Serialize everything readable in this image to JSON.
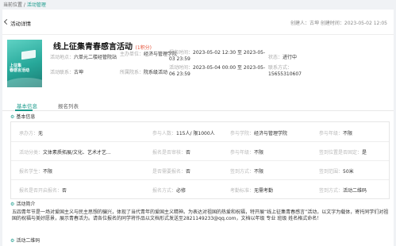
{
  "breadcrumb": {
    "prefix": "当前位置 / ",
    "current": "活动管理"
  },
  "header": {
    "title": "活动详情",
    "creator": "创建人：古坤  创建时间：2023-05-02 12:05"
  },
  "poster": {
    "text": "上征集\n春感言活动"
  },
  "activity": {
    "title": "线上征集青春感言活动",
    "credit": "(1积分)",
    "place_label": "活动地点：",
    "place_value": "六单元二楼经管院站",
    "org_label": "主办单位：",
    "org_value": "经济与管理学院",
    "time_label": "报名时间：",
    "time_value": "2023-05-02 12:30 至 2023-05-03 23:59",
    "status_label": "状态：",
    "status_value": "进行中",
    "contact_label": "活动联系：",
    "contact_value": "古坤",
    "college_label": "所属院系：",
    "college_value": "院系级活动",
    "act_time_label": "活动时间：",
    "act_time_value": "2023-05-04 00:00 至 2023-05-06 23:59",
    "phone_label": "联系方式：",
    "phone_value": "15655310607"
  },
  "tabs": {
    "basic": "基本信息",
    "list": "报名列表"
  },
  "basic": {
    "section_title": "基本信息",
    "r1": [
      {
        "lbl": "承办方：",
        "val": "无"
      },
      {
        "lbl": "参与人数：",
        "val": "115人/ 限1000人"
      },
      {
        "lbl": "参与学院：",
        "val": "经济与管理学院"
      },
      {
        "lbl": "参与年级：",
        "val": "不限"
      }
    ],
    "r2": [
      {
        "lbl": "活动分类：",
        "val": "文体素质拓展/文化、艺术才艺..."
      },
      {
        "lbl": "报名是否审核：",
        "val": "否"
      },
      {
        "lbl": "参与年级：",
        "val": "不限"
      },
      {
        "lbl": "签到位置是否固定：",
        "val": "是"
      }
    ],
    "r3": [
      {
        "lbl": "报名学生：",
        "val": "不限"
      },
      {
        "lbl": "是否需要报名：",
        "val": "否"
      },
      {
        "lbl": "签到方式：",
        "val": "不限"
      },
      {
        "lbl": "签到范围：",
        "val": "50米"
      }
    ],
    "r4": [
      {
        "lbl": "报名是否开启报名：",
        "val": "否"
      },
      {
        "lbl": "报名方式：",
        "val": "必修"
      },
      {
        "lbl": "考勤标准：",
        "val": "无需考勤"
      },
      {
        "lbl": "签到方式：",
        "val": "活动二维码"
      }
    ]
  },
  "intro": {
    "section_title": "活动简介",
    "text": "五四青年节是一场对爱国主义与民主思想的骗兴，体现了当代青年的爱国主义精神。为表达对祖国的热爱和祝福，特开展“线上征集青春感言”活动，以文字为载体，寄托同学们对祖国的祝福与美好愿景，展示青春活力。请各位报名的同学将作品以文档形式发送至2821149233@qq.com，文档以年级 专业 班级 姓名格式命名！"
  },
  "qr": {
    "section_title": "活动二维码"
  }
}
